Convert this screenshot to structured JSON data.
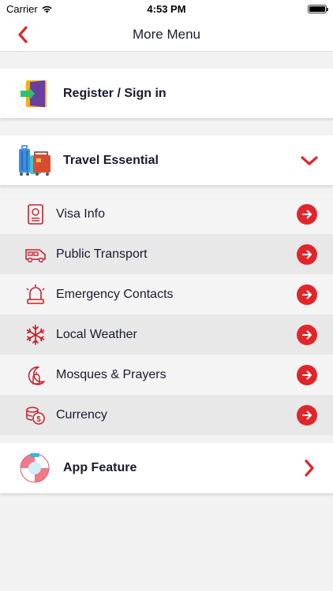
{
  "status_bar": {
    "carrier": "Carrier",
    "time": "4:53 PM"
  },
  "nav": {
    "title": "More Menu",
    "back_icon": "chevron-left-icon"
  },
  "register": {
    "label": "Register / Sign in",
    "icon": "door-icon"
  },
  "travel": {
    "label": "Travel Essential",
    "icon": "luggage-icon",
    "expanded": true,
    "items": [
      {
        "label": "Visa Info",
        "icon": "passport-icon"
      },
      {
        "label": "Public Transport",
        "icon": "bus-icon"
      },
      {
        "label": "Emergency Contacts",
        "icon": "siren-icon"
      },
      {
        "label": "Local Weather",
        "icon": "snowflake-icon"
      },
      {
        "label": "Mosques & Prayers",
        "icon": "mosque-icon"
      },
      {
        "label": "Currency",
        "icon": "coins-icon"
      }
    ]
  },
  "app_feature": {
    "label": "App Feature",
    "icon": "lifebuoy-icon"
  },
  "colors": {
    "accent": "#e0262b",
    "text": "#1a1a2e",
    "icon_red": "#c8202a"
  }
}
